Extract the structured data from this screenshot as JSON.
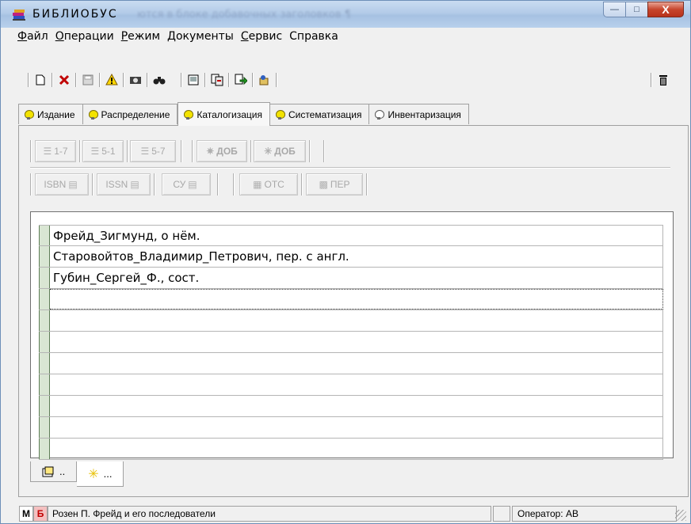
{
  "window": {
    "title": "БИБЛИОБУС",
    "title_ghost": "ются в блоке добавочных заголовков ¶",
    "controls": {
      "minimize": "—",
      "maximize": "□",
      "close": "X"
    }
  },
  "menu": [
    {
      "key": "Ф",
      "rest": "айл"
    },
    {
      "key": "О",
      "rest": "перации"
    },
    {
      "key": "Р",
      "rest": "ежим"
    },
    {
      "key": "Д",
      "rest": "окументы"
    },
    {
      "key": "С",
      "rest": "ервис"
    },
    {
      "key": "",
      "rest": "Справка"
    }
  ],
  "toolbar": {
    "icons": [
      "new-document-icon",
      "delete-x-icon",
      "save-icon",
      "warning-icon",
      "camera-icon",
      "binoculars-icon",
      "print-preview-icon",
      "copy-icon",
      "export-icon",
      "import-icon"
    ],
    "right_icon": "trash-icon"
  },
  "tabs": [
    {
      "label": "Издание",
      "lit": true,
      "active": false
    },
    {
      "label": "Распределение",
      "lit": true,
      "active": false
    },
    {
      "label": "Каталогизация",
      "lit": true,
      "active": true
    },
    {
      "label": "Систематизация",
      "lit": true,
      "active": false
    },
    {
      "label": "Инвентаризация",
      "lit": false,
      "active": false
    }
  ],
  "row1": {
    "b1": "1-7",
    "b2": "5-1",
    "b3": "5-7",
    "b4": "ДОБ",
    "b5": "ДОБ"
  },
  "row2": {
    "b1": "ISBN",
    "b2": "ISSN",
    "b3": "СУ",
    "b4": "ОТС",
    "b5": "ПЕР"
  },
  "grid": {
    "rows": [
      "Фрейд_Зигмунд, о нём.",
      "Старовойтов_Владимир_Петрович, пер. с англ.",
      "Губин_Сергей_Ф., сост.",
      "",
      "",
      "",
      "",
      "",
      "",
      "",
      ""
    ],
    "current_row": 3
  },
  "bottom_tabs": [
    {
      "label": "..",
      "icon": "document-icon",
      "active": false
    },
    {
      "label": "...",
      "icon": "sparkle-icon",
      "active": true
    }
  ],
  "status": {
    "m": "М",
    "b": "Б",
    "text": "Розен П. Фрейд и его последователи",
    "operator": "Оператор: АВ"
  }
}
